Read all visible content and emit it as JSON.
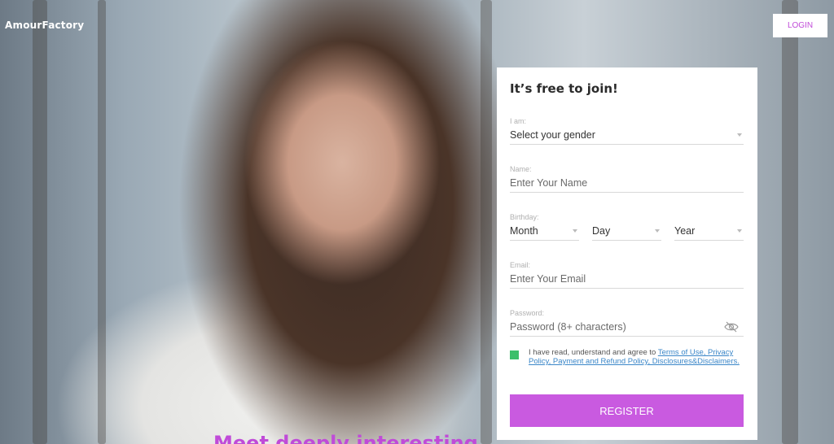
{
  "brand": {
    "logo": "AmourFactory"
  },
  "header": {
    "login_label": "LOGIN"
  },
  "form": {
    "title": "It’s free to join!",
    "gender": {
      "label": "I am:",
      "value": "Select your gender"
    },
    "name": {
      "label": "Name:",
      "placeholder": "Enter Your Name"
    },
    "birthday": {
      "label": "Birthday:",
      "month": "Month",
      "day": "Day",
      "year": "Year"
    },
    "email": {
      "label": "Email:",
      "placeholder": "Enter Your Email"
    },
    "password": {
      "label": "Password:",
      "placeholder": "Password (8+ characters)"
    },
    "agree": {
      "text": "I have read, understand and agree to ",
      "terms_link": "Terms of Use, Privacy Policy, Payment and Refund Policy, Disclosures&Disclaimers.",
      "checked": true
    },
    "register_label": "REGISTER"
  },
  "hero": {
    "headline": "Meet deeply interesting"
  },
  "colors": {
    "accent": "#c95ae0",
    "check": "#3cbf6a",
    "link": "#3a86c8"
  }
}
